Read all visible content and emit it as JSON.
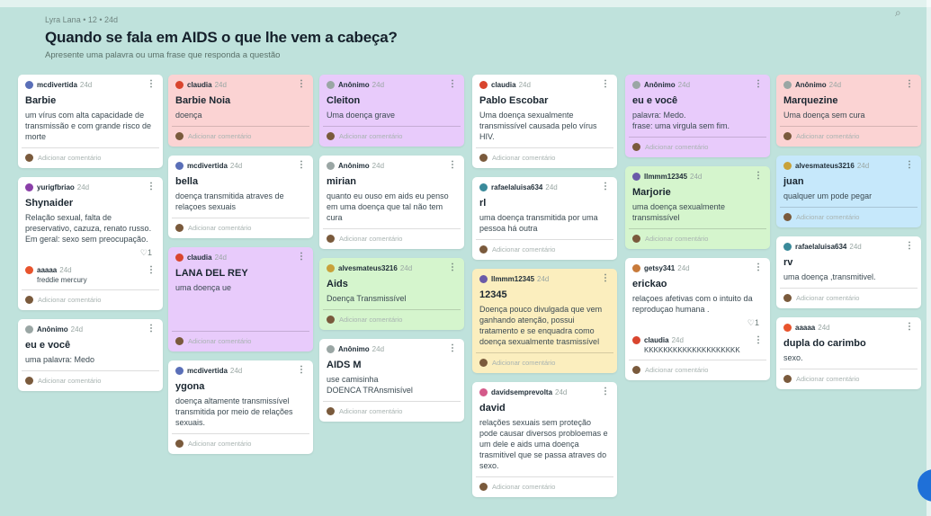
{
  "header": {
    "meta": "Lyra Lana • 12 • 24d",
    "title": "Quando se fala em AIDS o que lhe vem a cabeça?",
    "subtitle": "Apresente uma palavra ou uma frase que responda a questão"
  },
  "search_icon": "⌕",
  "add_comment": "Adicionar comentário",
  "colors": {
    "background": "#bfe2dc",
    "pink": "#fbd3d3",
    "purple": "#e8cbfb",
    "green": "#d5f5cd",
    "yellow": "#fbeebe",
    "blue": "#c6e8fb"
  },
  "columns": [
    {
      "cards": [
        {
          "author": "mcdivertida",
          "time": "24d",
          "title": "Barbie",
          "text": "um vírus com alta capacidade de transmissão e com grande risco de morte",
          "color": "white",
          "avatar": "#5a6fb8"
        },
        {
          "author": "yurigfbriao",
          "time": "24d",
          "title": "Shynaider",
          "text": "Relação sexual, falta de preservativo, cazuza, renato russo. Em geral: sexo sem preocupação.",
          "color": "white",
          "avatar": "#8a3fa8",
          "likes": "♡1",
          "reply": {
            "author": "aaaaa",
            "time": "24d",
            "text": "freddie mercury",
            "avatar": "#e8542d"
          }
        },
        {
          "author": "Anônimo",
          "time": "24d",
          "title": "eu e você",
          "text": "uma palavra: Medo",
          "color": "white",
          "avatar": "#9aa6a4"
        }
      ]
    },
    {
      "cards": [
        {
          "author": "claudia",
          "time": "24d",
          "title": "Barbie Noia",
          "text": "doença",
          "color": "pink",
          "avatar": "#d9452e"
        },
        {
          "author": "mcdivertida",
          "time": "24d",
          "title": "bella",
          "text": "doença transmitida atraves de relaçoes sexuais",
          "color": "white",
          "avatar": "#5a6fb8"
        },
        {
          "author": "claudia",
          "time": "24d",
          "title": "LANA DEL REY",
          "text": "uma doença ue",
          "color": "purple",
          "avatar": "#d9452e",
          "tall": true
        },
        {
          "author": "mcdivertida",
          "time": "24d",
          "title": "ygona",
          "text": "doença altamente transmissível transmitida por meio de relações sexuais.",
          "color": "white",
          "avatar": "#5a6fb8"
        }
      ]
    },
    {
      "cards": [
        {
          "author": "Anônimo",
          "time": "24d",
          "title": "Cleiton",
          "text": "Uma doença grave",
          "color": "purple",
          "avatar": "#9aa6a4"
        },
        {
          "author": "Anônimo",
          "time": "24d",
          "title": "mirian",
          "text": "quanto eu ouso em aids eu penso em uma doença que tal não tem cura",
          "color": "white",
          "avatar": "#9aa6a4"
        },
        {
          "author": "alvesmateus3216",
          "time": "24d",
          "title": "Aids",
          "text": "Doença Transmissível",
          "color": "green",
          "avatar": "#c8a23a"
        },
        {
          "author": "Anônimo",
          "time": "24d",
          "title": "AIDS M",
          "text": "use camisinha\nDOENCA TRAnsmisível",
          "color": "white",
          "avatar": "#9aa6a4"
        }
      ]
    },
    {
      "cards": [
        {
          "author": "claudia",
          "time": "24d",
          "title": "Pablo Escobar",
          "text": "Uma doença sexualmente transmissível causada pelo vírus HIV.",
          "color": "white",
          "avatar": "#d9452e"
        },
        {
          "author": "rafaelaluisa634",
          "time": "24d",
          "title": "rl",
          "text": "uma doença transmitida por uma pessoa há outra",
          "color": "white",
          "avatar": "#3a8a9a"
        },
        {
          "author": "llmmm12345",
          "time": "24d",
          "title": "12345",
          "text": "Doença pouco divulgada que vem ganhando atenção, possui tratamento e se enquadra como doença sexualmente trasmissível",
          "color": "yellow",
          "avatar": "#6a5aa8"
        },
        {
          "author": "davidsemprevolta",
          "time": "24d",
          "title": "david",
          "text": "relações sexuais sem proteção pode causar diversos probloemas e um dele e aids uma doença trasmitivel que se passa atraves do sexo.",
          "color": "white",
          "avatar": "#d45a8a"
        }
      ]
    },
    {
      "cards": [
        {
          "author": "Anônimo",
          "time": "24d",
          "title": "eu e você",
          "text": "palavra: Medo.\nfrase: uma virgula sem fim.",
          "color": "purple",
          "avatar": "#9aa6a4"
        },
        {
          "author": "llmmm12345",
          "time": "24d",
          "title": "Marjorie",
          "text": "uma doença sexualmente transmissível",
          "color": "green",
          "avatar": "#6a5aa8"
        },
        {
          "author": "getsy341",
          "time": "24d",
          "title": "erickao",
          "text": "relaçoes afetivas com o intuito da reproduçao humana .",
          "color": "white",
          "avatar": "#c87a3a",
          "likes": "♡1",
          "reply": {
            "author": "claudia",
            "time": "24d",
            "text": "KKKKKKKKKKKKKKKKKKKK",
            "avatar": "#d9452e"
          }
        }
      ]
    },
    {
      "cards": [
        {
          "author": "Anônimo",
          "time": "24d",
          "title": "Marquezine",
          "text": "Uma doença sem cura",
          "color": "pink",
          "avatar": "#9aa6a4"
        },
        {
          "author": "alvesmateus3216",
          "time": "24d",
          "title": "juan",
          "text": "qualquer um pode pegar",
          "color": "blue",
          "avatar": "#c8a23a"
        },
        {
          "author": "rafaelaluisa634",
          "time": "24d",
          "title": "rv",
          "text": "uma doença ,transmitivel.",
          "color": "white",
          "avatar": "#3a8a9a"
        },
        {
          "author": "aaaaa",
          "time": "24d",
          "title": "dupla do carimbo",
          "text": "sexo.",
          "color": "white",
          "avatar": "#e8542d"
        }
      ]
    }
  ]
}
